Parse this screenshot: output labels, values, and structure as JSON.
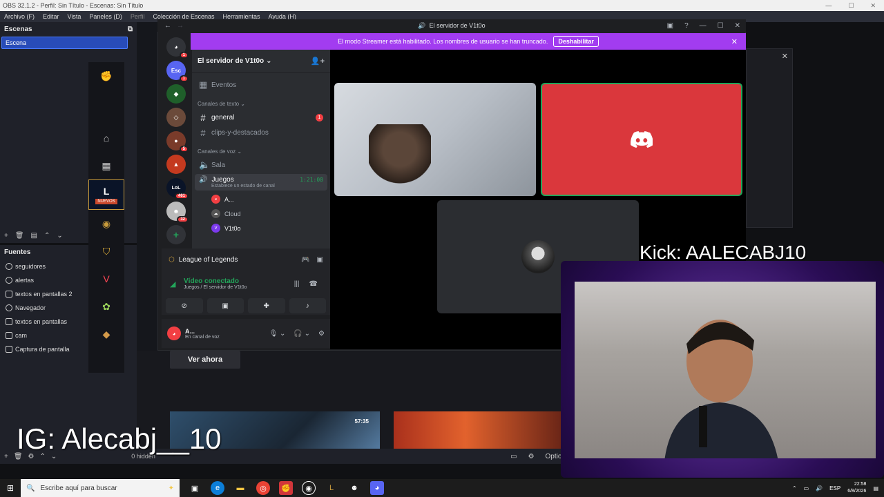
{
  "obs": {
    "window_title": "OBS 32.1.2 - Perfil: Sin Título - Escenas: Sin Título",
    "menu": [
      "Archivo (F)",
      "Editar",
      "Vista",
      "Paneles (D)",
      "Perfil",
      "Colección de Escenas",
      "Herramientas",
      "Ayuda (H)"
    ],
    "scenes_header": "Escenas",
    "scenes": [
      "Escena"
    ],
    "sources_header": "Fuentes",
    "sources": [
      {
        "label": "seguidores",
        "icon": "globe-icon"
      },
      {
        "label": "alertas",
        "icon": "globe-icon"
      },
      {
        "label": "textos en pantallas 2",
        "icon": "text-icon"
      },
      {
        "label": "Navegador",
        "icon": "globe-icon"
      },
      {
        "label": "textos en pantallas",
        "icon": "text-icon"
      },
      {
        "label": "cam",
        "icon": "camera-icon"
      },
      {
        "label": "Captura de pantalla",
        "icon": "monitor-icon"
      }
    ],
    "hidden_label": "0 hidden",
    "options_label": "Options"
  },
  "riot": {
    "tile_badge": "NUEVOS",
    "ver_ahora": "Ver ahora",
    "video_duration": "57:35"
  },
  "overlay": {
    "ig": "IG: Alecabj__10",
    "kick": "Kick: AALECABJ10"
  },
  "discord": {
    "window_title": "El servidor de V1t0o",
    "banner_text": "El modo Streamer está habilitado. Los nombres de usuario se han truncado.",
    "banner_button": "Deshabilitar",
    "server_name": "El servidor de V1t0o",
    "events": "Eventos",
    "text_category": "Canales de texto",
    "text_channels": [
      {
        "name": "general",
        "unread": "1"
      },
      {
        "name": "clips-y-destacados",
        "unread": ""
      }
    ],
    "voice_category": "Canales de voz",
    "voice_channels": [
      "Sala"
    ],
    "active_voice": {
      "name": "Juegos",
      "time": "1:21:08",
      "status": "Establece un estado de canal"
    },
    "members": [
      "A...",
      "Cloud",
      "V1t0o"
    ],
    "guild_badges": [
      "1",
      "1",
      "",
      "",
      "5",
      "",
      "461",
      "32"
    ],
    "guild_esc": "Esc",
    "activity": "League of Legends",
    "rtc_status": "Vídeo conectado",
    "rtc_sub": "Juegos / El servidor de V1t0o",
    "user_name": "A...",
    "user_status": "En canal de voz"
  },
  "taskbar": {
    "search_placeholder": "Escribe aquí para buscar",
    "lang": "ESP",
    "time": "22:58",
    "date": "6/8/2026"
  },
  "colors": {
    "discord_blurple": "#5865f2",
    "streamer_banner": "#a23cf0",
    "connected_green": "#23a55a",
    "discord_red": "#da373c"
  }
}
